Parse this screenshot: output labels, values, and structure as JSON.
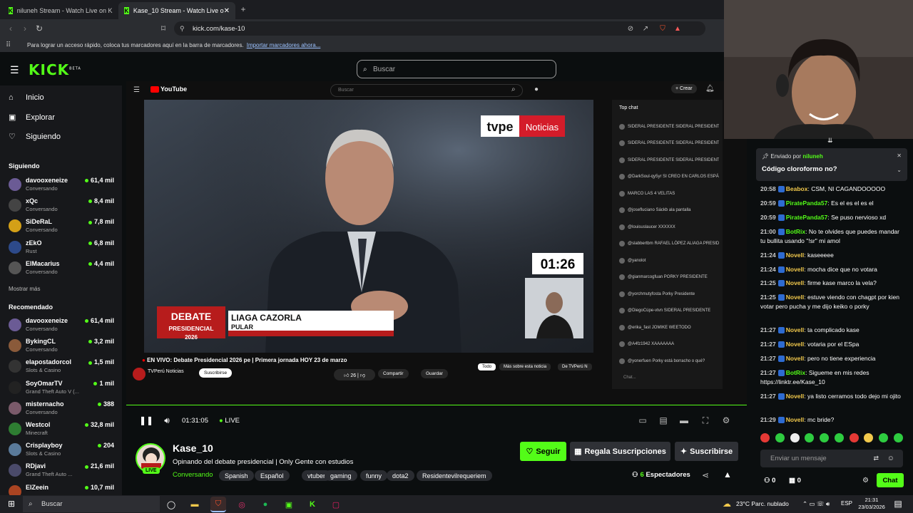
{
  "browser": {
    "tabs": [
      {
        "title": "niluneh Stream - Watch Live on K"
      },
      {
        "title": "Kase_10 Stream - Watch Live o"
      }
    ],
    "url": "kick.com/kase-10",
    "bookmarks_text": "Para lograr un acceso rápido, coloca tus marcadores aquí en la barra de marcadores.",
    "bookmarks_link": "Importar marcadores ahora..."
  },
  "header": {
    "logo": "KICK",
    "logo_beta": "BETA",
    "search_placeholder": "Buscar"
  },
  "sidebar": {
    "nav": [
      {
        "label": "Inicio",
        "icon": "home-icon"
      },
      {
        "label": "Explorar",
        "icon": "compass-icon"
      },
      {
        "label": "Siguiendo",
        "icon": "heart-icon"
      }
    ],
    "following_title": "Siguiendo",
    "following": [
      {
        "name": "davooxeneize",
        "sub": "Conversando",
        "viewers": "61,4 mil"
      },
      {
        "name": "xQc",
        "sub": "Conversando",
        "viewers": "8,4 mil"
      },
      {
        "name": "SiDeRaL",
        "sub": "Conversando",
        "viewers": "7,8 mil"
      },
      {
        "name": "zEkO",
        "sub": "Rust",
        "viewers": "6,8 mil"
      },
      {
        "name": "ElMacarius",
        "sub": "Conversando",
        "viewers": "4,4 mil"
      }
    ],
    "show_more": "Mostrar más",
    "recommended_title": "Recomendado",
    "recommended": [
      {
        "name": "davooxeneize",
        "sub": "Conversando",
        "viewers": "61,4 mil"
      },
      {
        "name": "BykingCL",
        "sub": "Conversando",
        "viewers": "3,2 mil"
      },
      {
        "name": "elapostadorcol",
        "sub": "Slots & Casino",
        "viewers": "1,5 mil"
      },
      {
        "name": "SoyOmarTV",
        "sub": "Grand Theft Auto V (...",
        "viewers": "1 mil"
      },
      {
        "name": "misternacho",
        "sub": "Conversando",
        "viewers": "388"
      },
      {
        "name": "Westcol",
        "sub": "Minecraft",
        "viewers": "32,8 mil"
      },
      {
        "name": "Crisplayboy",
        "sub": "Slots & Casino",
        "viewers": "204"
      },
      {
        "name": "RDjavi",
        "sub": "Grand Theft Auto ...",
        "viewers": "21,6 mil"
      },
      {
        "name": "ElZeein",
        "sub": "",
        "viewers": "10,7 mil"
      }
    ]
  },
  "video": {
    "yt_search": "Buscar",
    "yt_create": "+ Crear",
    "yt_logo": "YouTube",
    "tv_logo_a": "tvpe",
    "tv_logo_b": "Noticias",
    "clock": "01:26",
    "debate_line1": "DEBATE",
    "debate_line2": "PRESIDENCIAL",
    "debate_year": "2026",
    "lower_third_1": "LIAGA CAZORLA",
    "lower_third_2": "PULAR",
    "yt_title": "EN VIVO: Debate Presidencial 2026 pe | Primera jornada HOY 23 de marzo",
    "yt_channel": "TVPerú Noticias",
    "yt_subscribe": "Suscribirse",
    "yt_share": "Compartir",
    "yt_save": "Guardar",
    "yt_chip_all": "Todo",
    "yt_chip_more": "Más sobre esta noticia",
    "yt_chip_tv": "De TVPerú N",
    "yt_chat_title": "Top chat",
    "yt_chat_input": "Chat...",
    "yt_chat_lines": [
      "SIDERAL PRESIDENTE  SIDERAL PRESIDENTE",
      "SIDERAL PRESIDENTE  SIDERAL PRESIDENTE",
      "SIDERAL PRESIDENTE  SIDERAL PRESIDENTE",
      "@DarkSoul-qy5yr  SI CREO EN CARLOS ESPÁ",
      "MARCO LAS 4 VELITAS",
      "@josefluciano  Sáckb ala pantalla",
      "@louisuslaucer  XXXXXX",
      "@slabbertbm  RAFAEL LÓPEZ ALIAGA PRESIDENTE",
      "@yanolot",
      "@gianmarcogfuan  PORKY PRESIDENTE",
      "@yorchmutyfosta  Porky Presidente",
      "@DiegoCúpe-vtvn  SIDERAL PRESIDENTE",
      "@erika_fast  JOMIKE WEETODO",
      "@A4fz1942  XAAAAAAA",
      "@yonerfuen  Porky está borracho o qué?"
    ],
    "time": "01:31:05",
    "live": "LIVE"
  },
  "stream": {
    "streamer": "Kase_10",
    "live_badge": "LIVE",
    "title": "Opinando del debate presidencial | Only Gente con estudios",
    "category": "Conversando",
    "tags": [
      "Spanish",
      "Español",
      "vtuber",
      "gaming",
      "funny",
      "dota2",
      "Residentevilrequeriem"
    ],
    "follow": "Seguir",
    "gift": "Regala Suscripciones",
    "subscribe": "Suscribirse",
    "viewers": "6",
    "viewers_label": "Espectadores"
  },
  "chat": {
    "pinned_by_label": "Enviado por",
    "pinned_by": "niluneh",
    "pinned_text": "Código cloroformo no?",
    "messages": [
      {
        "time": "20:58",
        "user": "Beabox",
        "color": "#f2c94c",
        "text": "CSM, NI CAGANDOOOOO"
      },
      {
        "time": "20:59",
        "user": "PiratePanda57",
        "color": "#53fc18",
        "text": "Es el es el es el"
      },
      {
        "time": "20:59",
        "user": "PiratePanda57",
        "color": "#53fc18",
        "text": "Se puso nervioso xd"
      },
      {
        "time": "21:00",
        "user": "BotRix",
        "color": "#53fc18",
        "text": "No te olvides que puedes mandar tu bullita usando \"!sr\" mi amol"
      },
      {
        "time": "21:24",
        "user": "Novell",
        "color": "#f2c94c",
        "text": "kaseeeee"
      },
      {
        "time": "21:24",
        "user": "Novell",
        "color": "#f2c94c",
        "text": "mocha dice que no votara"
      },
      {
        "time": "21:25",
        "user": "Novell",
        "color": "#f2c94c",
        "text": "firme kase marco la vela?"
      },
      {
        "time": "21:25",
        "user": "Novell",
        "color": "#f2c94c",
        "text": "estuve viendo con chagpt por kien votar pero pucha y me dijo keiko o porky"
      },
      {
        "time": "21:27",
        "user": "Novell",
        "color": "#f2c94c",
        "text": "ta complicado kase"
      },
      {
        "time": "21:27",
        "user": "Novell",
        "color": "#f2c94c",
        "text": "votaria por el ESpa"
      },
      {
        "time": "21:27",
        "user": "Novell",
        "color": "#f2c94c",
        "text": "pero no tiene experiencia"
      },
      {
        "time": "21:27",
        "user": "BotRix",
        "color": "#53fc18",
        "text": "Sigueme en mis redes https://linktr.ee/Kase_10"
      },
      {
        "time": "21:27",
        "user": "Novell",
        "color": "#f2c94c",
        "text": "ya listo cerramos todo dejo mi ojito"
      },
      {
        "time": "21:29",
        "user": "Novell",
        "color": "#f2c94c",
        "text": "mc bride?"
      }
    ],
    "input_placeholder": "Enviar un mensaje",
    "points": "0",
    "gifts": "0",
    "send": "Chat"
  },
  "taskbar": {
    "search": "Buscar",
    "weather": "23°C  Parc. nublado",
    "lang": "ESP",
    "time": "21:31",
    "date": "23/03/2026"
  },
  "colors": {
    "kick_green": "#53fc18",
    "bg": "#0b0e0f",
    "sidebar": "#17181b"
  }
}
